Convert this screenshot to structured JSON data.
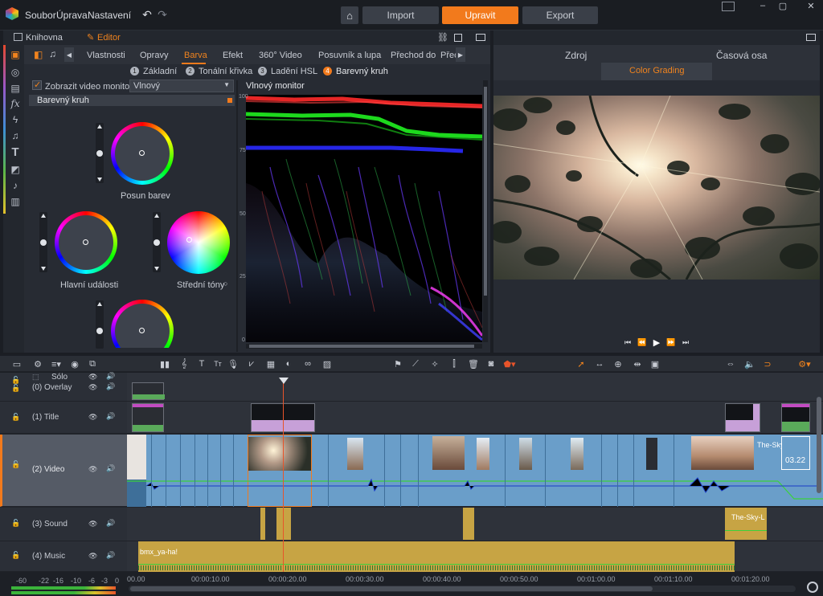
{
  "menu": {
    "file": "Soubor",
    "edit": "Úprava",
    "settings": "Nastavení"
  },
  "top_tabs": {
    "import": "Import",
    "edit": "Upravit",
    "export": "Export"
  },
  "left_panel": {
    "tab_library": "Knihovna",
    "tab_editor": "Editor",
    "tabs": [
      "Vlastnosti",
      "Opravy",
      "Barva",
      "Efekt",
      "360° Video",
      "Posuvník a lupa",
      "Přechod do",
      "Přec"
    ],
    "active_tab": "Barva",
    "subtabs": [
      {
        "num": "1",
        "label": "Základní"
      },
      {
        "num": "2",
        "label": "Tonální křivka"
      },
      {
        "num": "3",
        "label": "Ladění HSL"
      },
      {
        "num": "4",
        "label": "Barevný kruh"
      }
    ],
    "show_monitor_label": "Zobrazit video monitor",
    "monitor_select": "Vlnový",
    "section_title": "Barevný kruh",
    "wheels": {
      "shift": "Posun barev",
      "highlights": "Hlavní události",
      "midtones": "Střední tóny"
    },
    "waveform_title": "Vlnový monitor",
    "waveform_ticks": [
      "100",
      "75",
      "50",
      "25",
      "0"
    ]
  },
  "right_panel": {
    "tab_source": "Zdroj",
    "tab_timeline": "Časová osa",
    "subtab": "Color Grading"
  },
  "timeline": {
    "tracks": [
      {
        "label": "Sólo"
      },
      {
        "label": "(0) Overlay"
      },
      {
        "label": "(1) Title"
      },
      {
        "label": "(2) Video"
      },
      {
        "label": "(3) Sound"
      },
      {
        "label": "(4) Music"
      }
    ],
    "clip_names": {
      "video_end": "The-Sky-L",
      "video_duration": "03.22",
      "sound": "The-Sky-L",
      "music": "bmx_ya-ha!"
    },
    "ruler": [
      "00.00",
      "00:00:10.00",
      "00:00:20.00",
      "00:00:30.00",
      "00:00:40.00",
      "00:00:50.00",
      "00:01:00.00",
      "00:01:10.00",
      "00:01:20.00"
    ],
    "meter_scale": [
      "-60",
      "-22",
      "-16",
      "-10",
      "-6",
      "-3",
      "0"
    ]
  },
  "colors": {
    "accent": "#f27a1c",
    "clip_video": "#6a9ec9",
    "clip_audio": "#c7a444"
  }
}
